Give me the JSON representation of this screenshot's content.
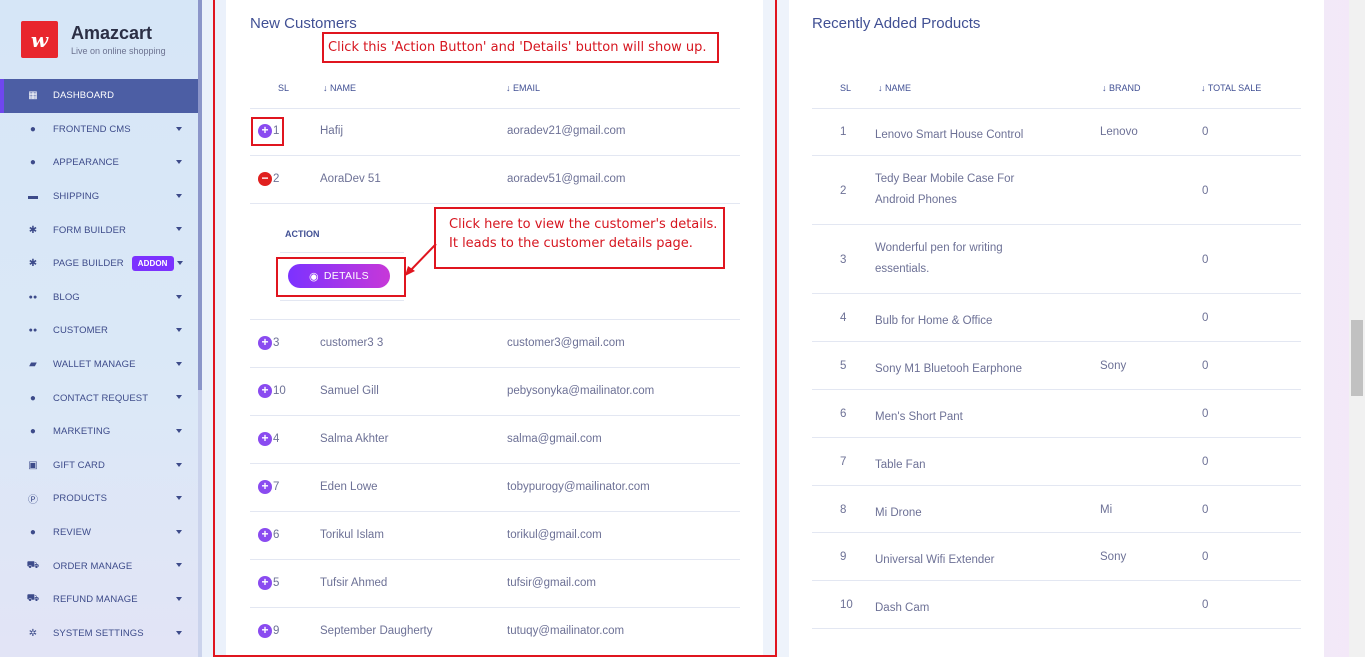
{
  "brand": {
    "name": "Amazcart",
    "tagline": "Live on online shopping",
    "logo_letter": "w"
  },
  "sidebar": {
    "items": [
      {
        "label": "DASHBOARD",
        "icon": "grid-icon",
        "active": true,
        "caret": false
      },
      {
        "label": "FRONTEND CMS",
        "icon": "user-icon",
        "caret": true
      },
      {
        "label": "APPEARANCE",
        "icon": "user-icon",
        "caret": true
      },
      {
        "label": "SHIPPING",
        "icon": "money-icon",
        "caret": true
      },
      {
        "label": "FORM BUILDER",
        "icon": "cogs-icon",
        "caret": true
      },
      {
        "label": "PAGE BUILDER",
        "icon": "cogs-icon",
        "caret": true,
        "badge": "ADDON"
      },
      {
        "label": "BLOG",
        "icon": "users-icon",
        "caret": true
      },
      {
        "label": "CUSTOMER",
        "icon": "users-icon",
        "caret": true
      },
      {
        "label": "WALLET MANAGE",
        "icon": "wallet-icon",
        "caret": true
      },
      {
        "label": "CONTACT REQUEST",
        "icon": "user-icon",
        "caret": true
      },
      {
        "label": "MARKETING",
        "icon": "user-icon",
        "caret": true
      },
      {
        "label": "GIFT CARD",
        "icon": "gift-icon",
        "caret": true
      },
      {
        "label": "PRODUCTS",
        "icon": "product-hunt-icon",
        "caret": true
      },
      {
        "label": "REVIEW",
        "icon": "user-icon",
        "caret": true
      },
      {
        "label": "ORDER MANAGE",
        "icon": "cart-icon",
        "caret": true
      },
      {
        "label": "REFUND MANAGE",
        "icon": "cart-icon",
        "caret": true
      },
      {
        "label": "SYSTEM SETTINGS",
        "icon": "gear-icon",
        "caret": true
      }
    ]
  },
  "new_customers": {
    "title": "New Customers",
    "headers": {
      "sl": "SL",
      "name": "NAME",
      "email": "EMAIL"
    },
    "rows_top": [
      {
        "sl": "1",
        "name": "Hafij",
        "email": "aoradev21@gmail.com",
        "state": "plus"
      },
      {
        "sl": "2",
        "name": "AoraDev 51",
        "email": "aoradev51@gmail.com",
        "state": "minus"
      }
    ],
    "expanded": {
      "action_label": "ACTION",
      "details_label": "DETAILS"
    },
    "rows_bottom": [
      {
        "sl": "3",
        "name": "customer3 3",
        "email": "customer3@gmail.com"
      },
      {
        "sl": "10",
        "name": "Samuel Gill",
        "email": "pebysonyka@mailinator.com"
      },
      {
        "sl": "4",
        "name": "Salma Akhter",
        "email": "salma@gmail.com"
      },
      {
        "sl": "7",
        "name": "Eden Lowe",
        "email": "tobypurogy@mailinator.com"
      },
      {
        "sl": "6",
        "name": "Torikul Islam",
        "email": "torikul@gmail.com"
      },
      {
        "sl": "5",
        "name": "Tufsir Ahmed",
        "email": "tufsir@gmail.com"
      },
      {
        "sl": "9",
        "name": "September Daugherty",
        "email": "tutuqy@mailinator.com"
      }
    ]
  },
  "recent_products": {
    "title": "Recently Added Products",
    "headers": {
      "sl": "SL",
      "name": "NAME",
      "brand": "BRAND",
      "total_sale": "TOTAL SALE"
    },
    "rows": [
      {
        "sl": "1",
        "name": "Lenovo Smart House Control",
        "brand": "Lenovo",
        "total": "0"
      },
      {
        "sl": "2",
        "name": "Tedy Bear Mobile Case For Android Phones",
        "brand": "",
        "total": "0"
      },
      {
        "sl": "3",
        "name": "Wonderful pen for writing essentials.",
        "brand": "",
        "total": "0"
      },
      {
        "sl": "4",
        "name": "Bulb for Home & Office",
        "brand": "",
        "total": "0"
      },
      {
        "sl": "5",
        "name": "Sony M1 Bluetooh Earphone",
        "brand": "Sony",
        "total": "0"
      },
      {
        "sl": "6",
        "name": "Men's Short Pant",
        "brand": "",
        "total": "0"
      },
      {
        "sl": "7",
        "name": "Table Fan",
        "brand": "",
        "total": "0"
      },
      {
        "sl": "8",
        "name": "Mi Drone",
        "brand": "Mi",
        "total": "0"
      },
      {
        "sl": "9",
        "name": "Universal Wifi Extender",
        "brand": "Sony",
        "total": "0"
      },
      {
        "sl": "10",
        "name": "Dash Cam",
        "brand": "",
        "total": "0"
      }
    ]
  },
  "annotations": {
    "action_note": "Click this 'Action Button' and 'Details' button will show up.",
    "details_note_line1": "Click here to view the customer's details.",
    "details_note_line2": "It leads to the customer details page."
  },
  "colors": {
    "accent": "#7c32ff",
    "accent2": "#c738d8",
    "annotation_red": "#e0151f",
    "sidebar_active": "#4c5ea4"
  }
}
